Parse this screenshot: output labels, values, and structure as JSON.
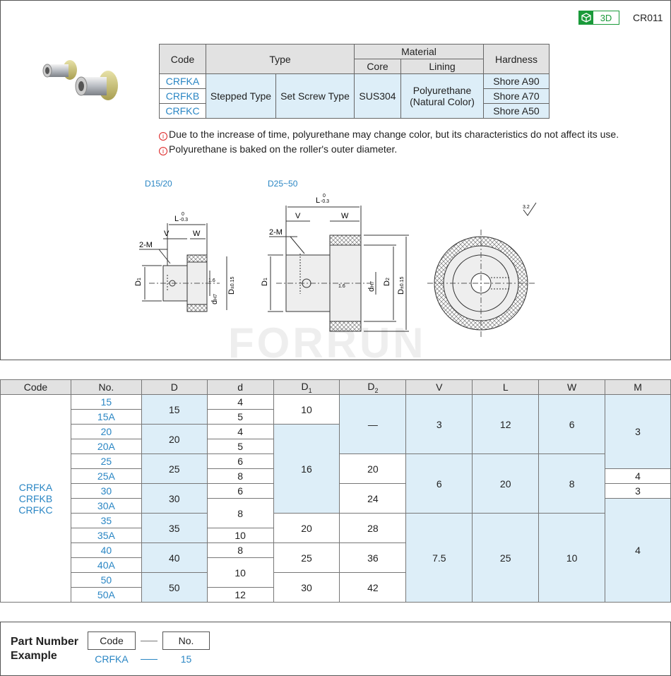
{
  "header": {
    "badge": "3D",
    "catalog_code": "CR011"
  },
  "spec_table": {
    "h_code": "Code",
    "h_type": "Type",
    "h_material": "Material",
    "h_core": "Core",
    "h_lining": "Lining",
    "h_hardness": "Hardness",
    "codes": [
      "CRFKA",
      "CRFKB",
      "CRFKC"
    ],
    "type1": "Stepped Type",
    "type2": "Set Screw Type",
    "core": "SUS304",
    "lining1": "Polyurethane",
    "lining2": "(Natural Color)",
    "hardness": [
      "Shore A90",
      "Shore A70",
      "Shore A50"
    ]
  },
  "notes": [
    "Due to the increase of time, polyurethane may change color, but its characteristics do not affect its use.",
    "Polyurethane is baked on the roller's outer diameter."
  ],
  "drawing": {
    "label_small": "D15/20",
    "label_large": "D25~50",
    "L": "L",
    "L_tol_top": "0",
    "L_tol_bot": "-0.3",
    "V": "V",
    "W": "W",
    "M": "2-M",
    "D1": "D",
    "D1_sub": "1",
    "D": "D",
    "D_tol": "±0.15",
    "d": "d",
    "d_tol": "H7",
    "D2": "D",
    "D2_sub": "2",
    "rough1": "1.6",
    "rough2": "3.2",
    "watermark": "FORRUN"
  },
  "dims_table": {
    "headers": [
      "Code",
      "No.",
      "D",
      "d",
      "D",
      "D",
      "V",
      "L",
      "W",
      "M"
    ],
    "header_subs": [
      "",
      "",
      "",
      "",
      "1",
      "2",
      "",
      "",
      "",
      ""
    ],
    "code_cell": [
      "CRFKA",
      "CRFKB",
      "CRFKC"
    ],
    "no": [
      "15",
      "15A",
      "20",
      "20A",
      "25",
      "25A",
      "30",
      "30A",
      "35",
      "35A",
      "40",
      "40A",
      "50",
      "50A"
    ],
    "D": [
      "15",
      "20",
      "25",
      "30",
      "35",
      "40",
      "50"
    ],
    "d": [
      "4",
      "5",
      "4",
      "5",
      "6",
      "8",
      "6",
      "8",
      "10",
      "8",
      "10",
      "12"
    ],
    "D1": [
      "10",
      "16",
      "20",
      "25",
      "30"
    ],
    "D2": [
      "—",
      "20",
      "24",
      "28",
      "36",
      "42"
    ],
    "V": [
      "3",
      "6",
      "7.5"
    ],
    "L": [
      "12",
      "20",
      "25"
    ],
    "W": [
      "6",
      "8",
      "10"
    ],
    "M": [
      "3",
      "4",
      "3",
      "4"
    ]
  },
  "part_number": {
    "title1": "Part Number",
    "title2": "Example",
    "code_label": "Code",
    "no_label": "No.",
    "code_example": "CRFKA",
    "no_example": "15"
  }
}
